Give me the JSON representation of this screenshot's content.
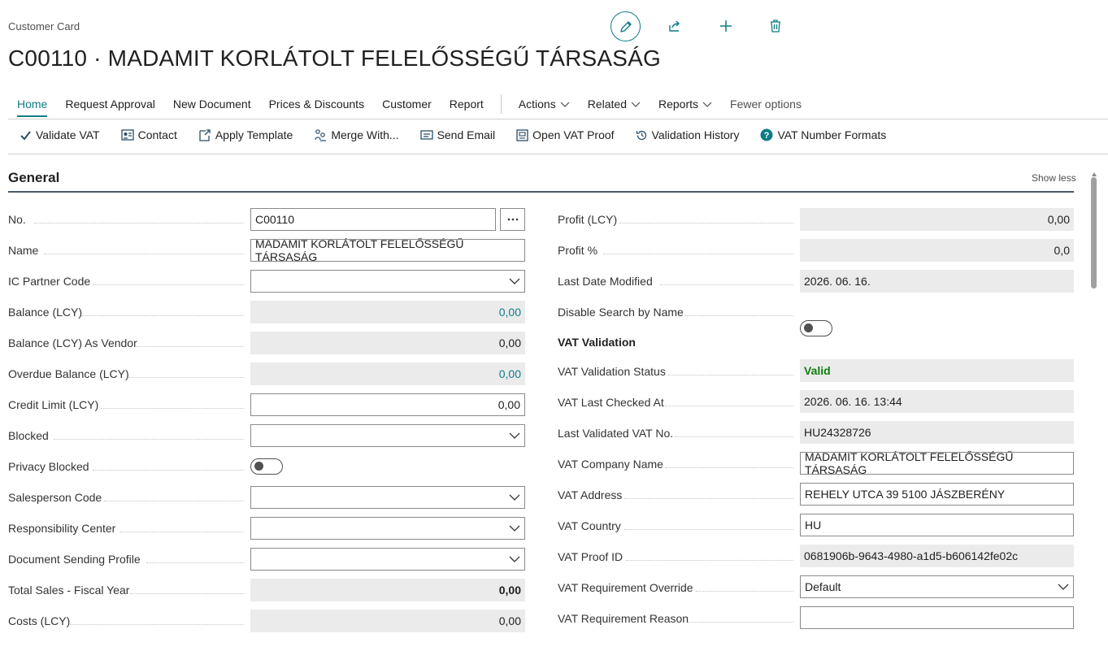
{
  "header": {
    "breadcrumb": "Customer Card",
    "title": "C00110 · MADAMIT KORLÁTOLT FELELŐSSÉGŰ TÁRSASÁG"
  },
  "menu": {
    "items": [
      "Home",
      "Request Approval",
      "New Document",
      "Prices & Discounts",
      "Customer",
      "Report"
    ],
    "dropdowns": [
      "Actions",
      "Related",
      "Reports"
    ],
    "fewer": "Fewer options"
  },
  "toolbar": [
    "Validate VAT",
    "Contact",
    "Apply Template",
    "Merge With...",
    "Send Email",
    "Open VAT Proof",
    "Validation History",
    "VAT Number Formats"
  ],
  "section": {
    "title": "General",
    "show_less": "Show less"
  },
  "left_fields": [
    {
      "label": "No.",
      "value": "C00110"
    },
    {
      "label": "Name",
      "value": "MADAMIT KORLÁTOLT FELELŐSSÉGŰ TÁRSASÁG"
    },
    {
      "label": "IC Partner Code",
      "value": ""
    },
    {
      "label": "Balance (LCY)",
      "value": "0,00"
    },
    {
      "label": "Balance (LCY) As Vendor",
      "value": "0,00"
    },
    {
      "label": "Overdue Balance (LCY)",
      "value": "0,00"
    },
    {
      "label": "Credit Limit (LCY)",
      "value": "0,00"
    },
    {
      "label": "Blocked",
      "value": ""
    },
    {
      "label": "Privacy Blocked",
      "value": ""
    },
    {
      "label": "Salesperson Code",
      "value": ""
    },
    {
      "label": "Responsibility Center",
      "value": ""
    },
    {
      "label": "Document Sending Profile",
      "value": ""
    },
    {
      "label": "Total Sales - Fiscal Year",
      "value": "0,00"
    },
    {
      "label": "Costs (LCY)",
      "value": "0,00"
    }
  ],
  "right_fields": [
    {
      "label": "Profit (LCY)",
      "value": "0,00"
    },
    {
      "label": "Profit %",
      "value": "0,0"
    },
    {
      "label": "Last Date Modified",
      "value": "2026. 06. 16."
    },
    {
      "label": "Disable Search by Name",
      "value": ""
    },
    {
      "label": "VAT Validation",
      "value": ""
    },
    {
      "label": "VAT Validation Status",
      "value": "Valid"
    },
    {
      "label": "VAT Last Checked At",
      "value": "2026. 06. 16. 13:44"
    },
    {
      "label": "Last Validated VAT No.",
      "value": "HU24328726"
    },
    {
      "label": "VAT Company Name",
      "value": "MADAMIT KORLÁTOLT FELELŐSSÉGŰ TÁRSASÁG"
    },
    {
      "label": "VAT Address",
      "value": "REHELY UTCA 39 5100 JÁSZBERÉNY"
    },
    {
      "label": "VAT Country",
      "value": "HU"
    },
    {
      "label": "VAT Proof ID",
      "value": "0681906b-9643-4980-a1d5-b606142fe02c"
    },
    {
      "label": "VAT Requirement Override",
      "value": "Default"
    },
    {
      "label": "VAT Requirement Reason",
      "value": ""
    }
  ],
  "colors": {
    "accent": "#0e7c86",
    "valid": "#107c10",
    "readonly_bg": "#ebebeb"
  },
  "icons": [
    "edit-icon",
    "share-icon",
    "new-icon",
    "delete-icon",
    "checkmark-icon",
    "contact-icon",
    "apply-template-icon",
    "merge-icon",
    "email-icon",
    "document-icon",
    "history-icon",
    "help-icon",
    "chevron-down-icon",
    "ellipsis-icon"
  ]
}
